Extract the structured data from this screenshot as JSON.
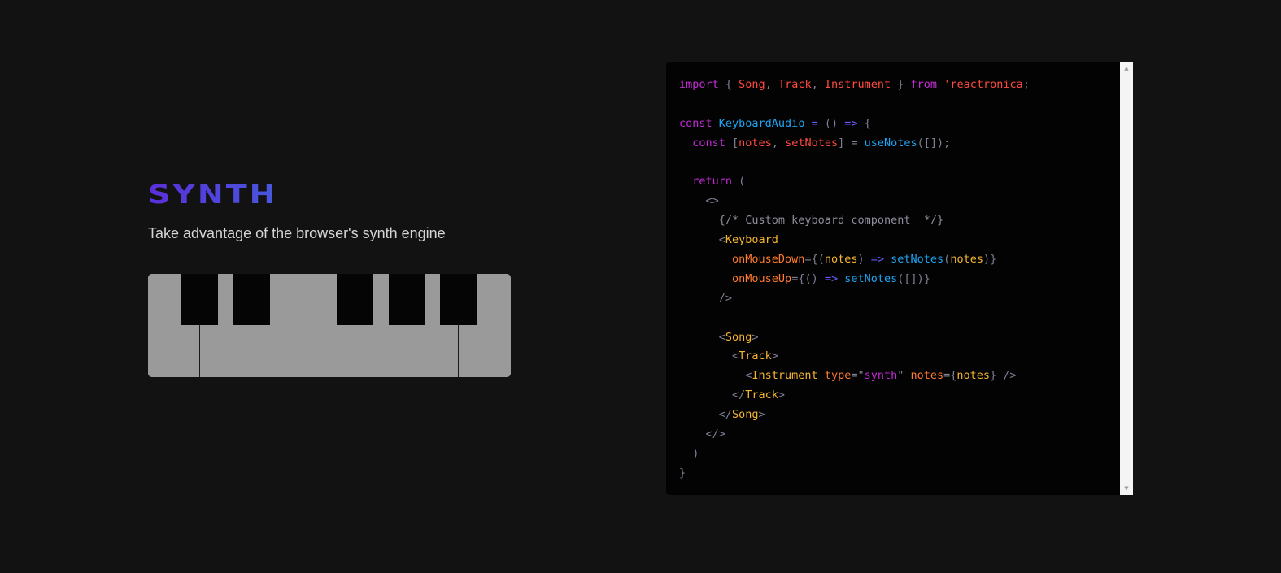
{
  "hero": {
    "title": "SYNTH",
    "subtitle": "Take advantage of the browser's synth engine"
  },
  "keyboard": {
    "white_keys": 7,
    "black_keys": 5
  },
  "code": {
    "lines": [
      [
        [
          "kw",
          "import"
        ],
        [
          "pun",
          " { "
        ],
        [
          "id",
          "Song"
        ],
        [
          "pun",
          ", "
        ],
        [
          "id",
          "Track"
        ],
        [
          "pun",
          ", "
        ],
        [
          "id",
          "Instrument"
        ],
        [
          "pun",
          " } "
        ],
        [
          "kw",
          "from"
        ],
        [
          "pun",
          " "
        ],
        [
          "id",
          "'reactronica"
        ],
        [
          "pun",
          ";"
        ]
      ],
      [],
      [
        [
          "kw",
          "const"
        ],
        [
          "pun",
          " "
        ],
        [
          "fn",
          "KeyboardAudio"
        ],
        [
          "pun",
          " "
        ],
        [
          "op",
          "="
        ],
        [
          "pun",
          " () "
        ],
        [
          "op",
          "=>"
        ],
        [
          "pun",
          " {"
        ]
      ],
      [
        [
          "pun",
          "  "
        ],
        [
          "kw",
          "const"
        ],
        [
          "pun",
          " ["
        ],
        [
          "id",
          "notes"
        ],
        [
          "pun",
          ", "
        ],
        [
          "id",
          "setNotes"
        ],
        [
          "pun",
          "] = "
        ],
        [
          "fn",
          "useNotes"
        ],
        [
          "pun",
          "([]);"
        ]
      ],
      [],
      [
        [
          "pun",
          "  "
        ],
        [
          "kw",
          "return"
        ],
        [
          "pun",
          " ("
        ]
      ],
      [
        [
          "pun",
          "    <>"
        ]
      ],
      [
        [
          "cmt",
          "      {/* Custom keyboard component  */}"
        ]
      ],
      [
        [
          "pun",
          "      <"
        ],
        [
          "comp",
          "Keyboard"
        ]
      ],
      [
        [
          "pun",
          "        "
        ],
        [
          "attr",
          "onMouseDown"
        ],
        [
          "pun",
          "={("
        ],
        [
          "var",
          "notes"
        ],
        [
          "pun",
          ") "
        ],
        [
          "op",
          "=>"
        ],
        [
          "pun",
          " "
        ],
        [
          "fn",
          "setNotes"
        ],
        [
          "pun",
          "("
        ],
        [
          "var",
          "notes"
        ],
        [
          "pun",
          ")}"
        ]
      ],
      [
        [
          "pun",
          "        "
        ],
        [
          "attr",
          "onMouseUp"
        ],
        [
          "pun",
          "={() "
        ],
        [
          "op",
          "=>"
        ],
        [
          "pun",
          " "
        ],
        [
          "fn",
          "setNotes"
        ],
        [
          "pun",
          "([])}"
        ]
      ],
      [
        [
          "pun",
          "      />"
        ]
      ],
      [],
      [
        [
          "pun",
          "      <"
        ],
        [
          "comp",
          "Song"
        ],
        [
          "pun",
          ">"
        ]
      ],
      [
        [
          "pun",
          "        <"
        ],
        [
          "comp",
          "Track"
        ],
        [
          "pun",
          ">"
        ]
      ],
      [
        [
          "pun",
          "          <"
        ],
        [
          "comp",
          "Instrument"
        ],
        [
          "pun",
          " "
        ],
        [
          "attr",
          "type"
        ],
        [
          "pun",
          "=\""
        ],
        [
          "str",
          "synth"
        ],
        [
          "pun",
          "\" "
        ],
        [
          "attr",
          "notes"
        ],
        [
          "pun",
          "={"
        ],
        [
          "var",
          "notes"
        ],
        [
          "pun",
          "} />"
        ]
      ],
      [
        [
          "pun",
          "        </"
        ],
        [
          "comp",
          "Track"
        ],
        [
          "pun",
          ">"
        ]
      ],
      [
        [
          "pun",
          "      </"
        ],
        [
          "comp",
          "Song"
        ],
        [
          "pun",
          ">"
        ]
      ],
      [
        [
          "pun",
          "    </>"
        ]
      ],
      [
        [
          "pun",
          "  )"
        ]
      ],
      [
        [
          "pun",
          "}"
        ]
      ]
    ]
  },
  "scrollbar": {
    "up_icon": "scroll-up-arrow-icon",
    "down_icon": "scroll-down-arrow-icon",
    "up_glyph": "▲",
    "down_glyph": "▼"
  },
  "colors": {
    "background": "#121212",
    "code_background": "#030303",
    "title_gradient_start": "#5a2fd9",
    "title_gradient_end": "#2f93e8",
    "white_key": "#9a9a9a",
    "black_key": "#050505"
  }
}
